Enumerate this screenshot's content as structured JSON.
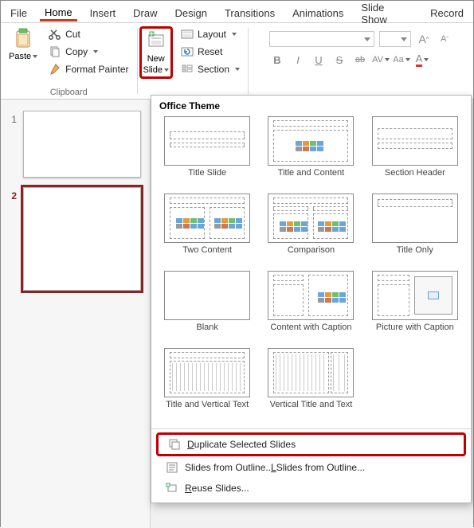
{
  "tabs": [
    "File",
    "Home",
    "Insert",
    "Draw",
    "Design",
    "Transitions",
    "Animations",
    "Slide Show",
    "Record"
  ],
  "active_tab": "Home",
  "clipboard": {
    "paste": "Paste",
    "cut": "Cut",
    "copy": "Copy",
    "format_painter": "Format Painter",
    "group_label": "Clipboard"
  },
  "slides_group": {
    "new_slide_l1": "New",
    "new_slide_l2": "Slide",
    "layout": "Layout",
    "reset": "Reset",
    "section": "Section"
  },
  "font": {
    "name_placeholder": "",
    "size_placeholder": "",
    "inc": "A",
    "dec": "A",
    "b": "B",
    "i": "I",
    "u": "U",
    "s": "S",
    "ab": "ab",
    "av": "AV",
    "aa": "Aa",
    "a": "A"
  },
  "thumbnails": [
    {
      "num": "1",
      "selected": false
    },
    {
      "num": "2",
      "selected": true
    }
  ],
  "dropdown": {
    "title": "Office Theme",
    "layouts": [
      "Title Slide",
      "Title and Content",
      "Section Header",
      "Two Content",
      "Comparison",
      "Title Only",
      "Blank",
      "Content with Caption",
      "Picture with Caption",
      "Title and Vertical Text",
      "Vertical Title and Text"
    ],
    "duplicate": "Duplicate Selected Slides",
    "outline": "Slides from Outline...",
    "reuse": "Reuse Slides...",
    "accel_dup": "D",
    "accel_out": "L",
    "accel_reuse": "R"
  }
}
